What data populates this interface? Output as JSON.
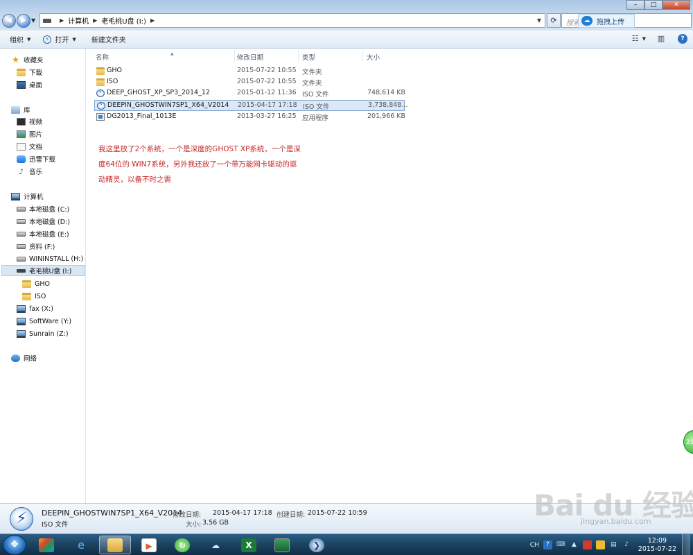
{
  "address": {
    "breadcrumbs": [
      "计算机",
      "老毛桃U盘 (I:)"
    ],
    "search_placeholder": "搜索 老毛桃U盘 (I:)",
    "cloud_upload_label": "拖拽上传"
  },
  "toolbar": {
    "organize_label": "组织",
    "open_label": "打开",
    "new_folder_label": "新建文件夹"
  },
  "navigation": {
    "favorites": {
      "label": "收藏夹",
      "items": [
        "下载",
        "桌面"
      ]
    },
    "libraries": {
      "label": "库",
      "items": [
        "视频",
        "图片",
        "文档",
        "迅雷下载",
        "音乐"
      ]
    },
    "computer": {
      "label": "计算机",
      "drives": [
        "本地磁盘 (C:)",
        "本地磁盘 (D:)",
        "本地磁盘 (E:)",
        "资料 (F:)",
        "WININSTALL (H:)",
        "老毛桃U盘 (I:)"
      ],
      "subfolders": [
        "GHO",
        "ISO"
      ],
      "network_drives": [
        "fax  (X:)",
        "SoftWare  (Y:)",
        "Sunrain (Z:)"
      ]
    },
    "network": {
      "label": "网络"
    }
  },
  "columns": {
    "name": "名称",
    "modified": "修改日期",
    "type": "类型",
    "size": "大小"
  },
  "files": [
    {
      "name": "GHO",
      "modified": "2015-07-22 10:55",
      "type": "文件夹",
      "size": "",
      "icon": "folder-icon"
    },
    {
      "name": "ISO",
      "modified": "2015-07-22 10:55",
      "type": "文件夹",
      "size": "",
      "icon": "folder-icon"
    },
    {
      "name": "DEEP_GHOST_XP_SP3_2014_12",
      "modified": "2015-01-12 11:36",
      "type": "ISO 文件",
      "size": "748,614 KB",
      "icon": "iso-file-icon"
    },
    {
      "name": "DEEPIN_GHOSTWIN7SP1_X64_V2014",
      "modified": "2015-04-17 17:18",
      "type": "ISO 文件",
      "size": "3,738,848...",
      "icon": "iso-file-icon"
    },
    {
      "name": "DG2013_Final_1013E",
      "modified": "2013-03-27 16:25",
      "type": "应用程序",
      "size": "201,966 KB",
      "icon": "application-icon"
    }
  ],
  "annotation": {
    "lines": [
      "我这里放了2个系统，一个是深度的GHOST XP系统，一个是深",
      "度64位的 WIN7系统，另外我还放了一个带万能网卡驱动的驱",
      "动精灵，以备不时之需"
    ],
    "color": "#c62828"
  },
  "details": {
    "name": "DEEPIN_GHOSTWIN7SP1_X64_V2014",
    "type": "ISO 文件",
    "modified_label": "修改日期:",
    "modified_value": "2015-04-17 17:18",
    "size_label": "大小:",
    "size_value": "3.56 GB",
    "created_label": "创建日期:",
    "created_value": "2015-07-22 10:59"
  },
  "watermark": {
    "logo": "Bai du 经验",
    "url": "jingyan.baidu.com"
  },
  "side_bubble": "21",
  "taskbar": {
    "tray_language": "CH",
    "clock_time": "12:09",
    "clock_date": "2015-07-22"
  },
  "colors": {
    "selection": "#dbe8f7",
    "accent": "#2a64a8",
    "taskbar": "#1c4564"
  }
}
